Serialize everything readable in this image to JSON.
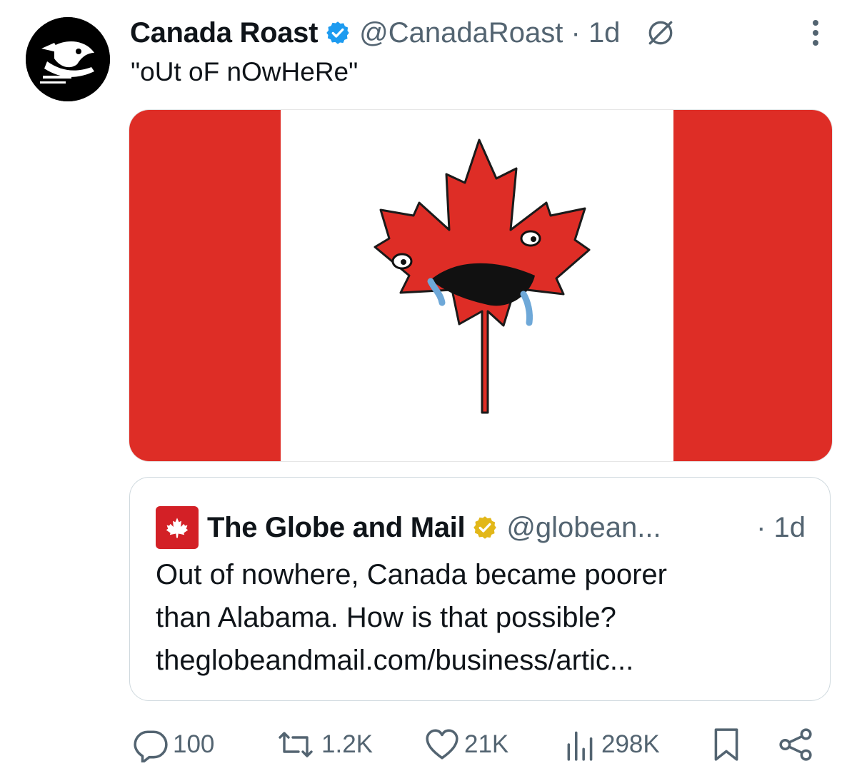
{
  "tweet": {
    "display_name": "Canada Roast",
    "handle": "@CanadaRoast",
    "separator": "·",
    "time": "1d",
    "text": "\"oUt oF nOwHeRe\"",
    "avatar_icon": "duck-logo-icon",
    "media": {
      "description_icon": "crying-maple-leaf-flag",
      "colors": {
        "red": "#de2d26",
        "white": "#ffffff"
      }
    }
  },
  "quote": {
    "display_name": "The Globe and Mail",
    "handle": "@globean...",
    "time": "· 1d",
    "text_lines": [
      "Out of nowhere, Canada became poorer",
      "than Alabama. How is that possible?",
      "theglobeandmail.com/business/artic..."
    ],
    "avatar_icon": "maple-leaf-icon",
    "badge": "gold-verified-icon"
  },
  "actions": {
    "replies": "100",
    "reposts": "1.2K",
    "likes": "21K",
    "views": "298K"
  },
  "colors": {
    "text": "#0f1419",
    "secondary": "#536471",
    "blue_check": "#1d9bf0",
    "gold_check": "#e2b719",
    "border": "#cfd9de"
  }
}
